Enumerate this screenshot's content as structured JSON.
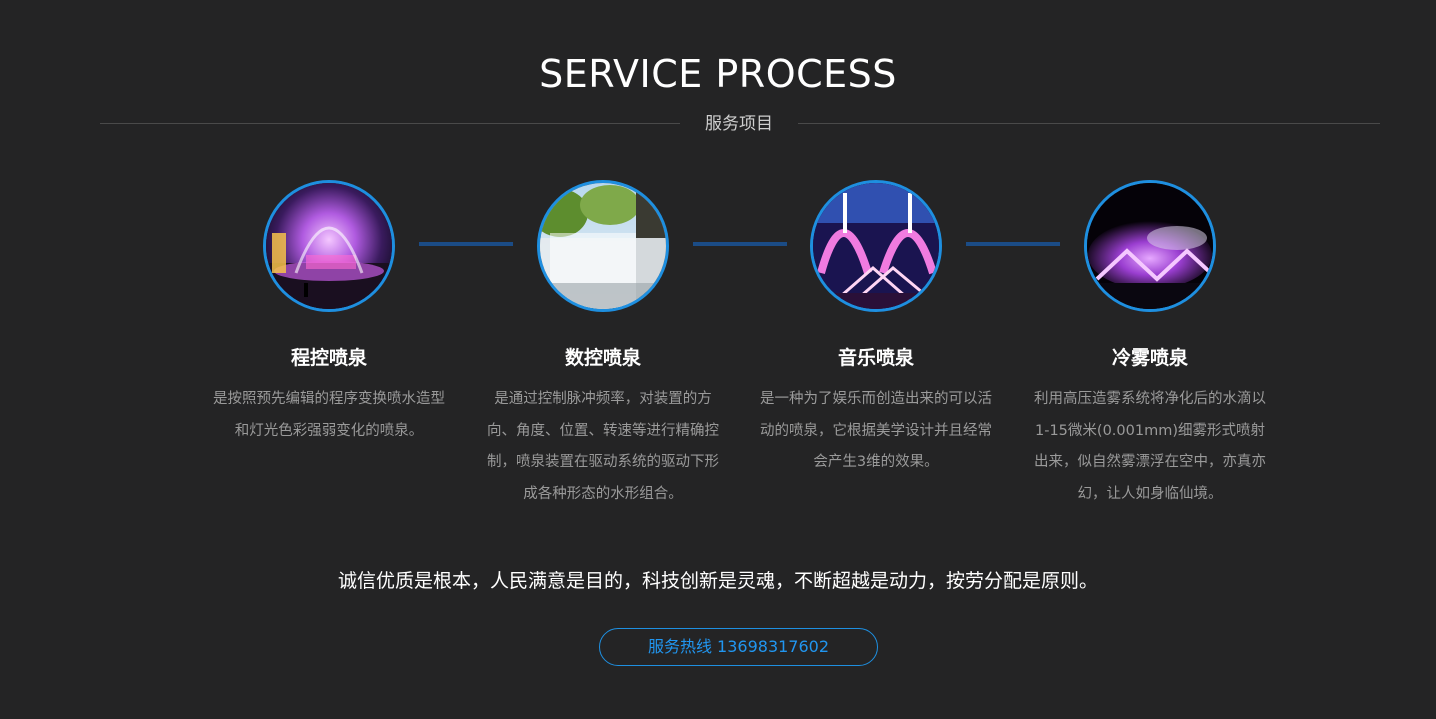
{
  "header": {
    "title": "SERVICE PROCESS",
    "subtitle": "服务项目"
  },
  "services": [
    {
      "title": "程控喷泉",
      "description": "是按照预先编辑的程序变换喷水造型和灯光色彩强弱变化的喷泉。",
      "image": "night-fountain-photo"
    },
    {
      "title": "数控喷泉",
      "description": "是通过控制脉冲频率，对装置的方向、角度、位置、转速等进行精确控制，喷泉装置在驱动系统的驱动下形成各种形态的水形组合。",
      "image": "park-mist-fountain-photo"
    },
    {
      "title": "音乐喷泉",
      "description": "是一种为了娱乐而创造出来的可以活动的喷泉，它根据美学设计并且经常会产生3维的效果。",
      "image": "musical-light-fountain-photo"
    },
    {
      "title": "冷雾喷泉",
      "description": "利用高压造雾系统将净化后的水滴以1-15微米(0.001mm)细雾形式喷射出来，似自然雾漂浮在空中，亦真亦幻，让人如身临仙境。",
      "image": "cold-mist-fountain-photo"
    }
  ],
  "motto": "诚信优质是根本，人民满意是目的，科技创新是灵魂，不断超越是动力，按劳分配是原则。",
  "hotline": {
    "label": "服务热线 13698317602"
  },
  "colors": {
    "background": "#242425",
    "accent": "#1e8fe0",
    "connector": "#1b4c86"
  }
}
